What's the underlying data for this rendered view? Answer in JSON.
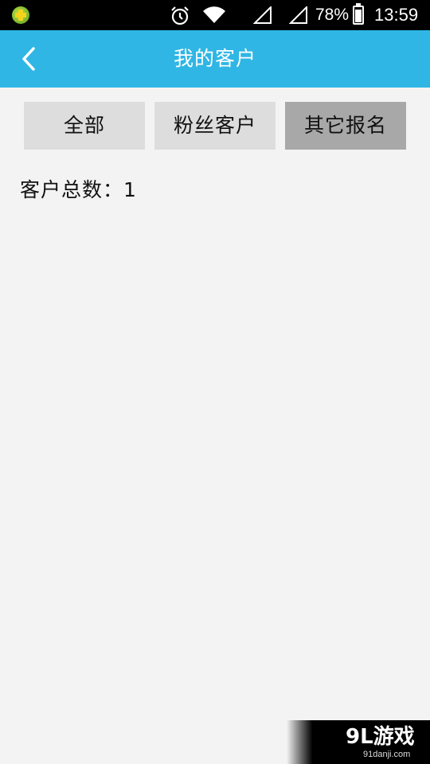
{
  "status_bar": {
    "app_icon": "app-plus-icon",
    "alarm_icon": "alarm-icon",
    "wifi_icon": "wifi-icon",
    "signal_icons": [
      "signal-icon",
      "signal-icon"
    ],
    "battery_percent": "78%",
    "battery_level": 0.78,
    "time": "13:59"
  },
  "nav": {
    "back_icon": "chevron-left-icon",
    "title": "我的客户"
  },
  "tabs": [
    {
      "label": "全部",
      "active": false
    },
    {
      "label": "粉丝客户",
      "active": false
    },
    {
      "label": "其它报名",
      "active": true
    }
  ],
  "summary": {
    "total_label": "客户总数：1"
  },
  "watermark": {
    "logo": "9L游戏",
    "url": "91danji.com"
  },
  "colors": {
    "nav_background": "#2fb6e5",
    "page_background": "#f3f3f3",
    "tab_background": "#dddddd",
    "tab_active_background": "#a8a8a8"
  }
}
